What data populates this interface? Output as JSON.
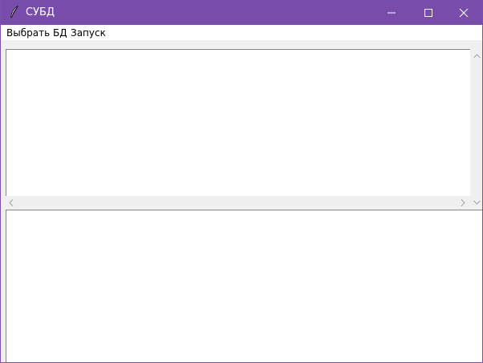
{
  "window": {
    "title": "СУБД",
    "icon": "feather-icon",
    "controls": [
      "minimize-icon",
      "maximize-icon",
      "close-icon"
    ],
    "titlebar_color": "#774cab"
  },
  "menubar": {
    "items": [
      {
        "label": "Выбрать БД"
      },
      {
        "label": "Запуск"
      }
    ]
  },
  "query_editor": {
    "value": ""
  },
  "results_area": {
    "value": ""
  },
  "scrollbars": {
    "vertical_icons": [
      "chevron-up-icon",
      "chevron-down-icon"
    ],
    "horizontal_icons": [
      "chevron-left-icon",
      "chevron-right-icon"
    ]
  }
}
